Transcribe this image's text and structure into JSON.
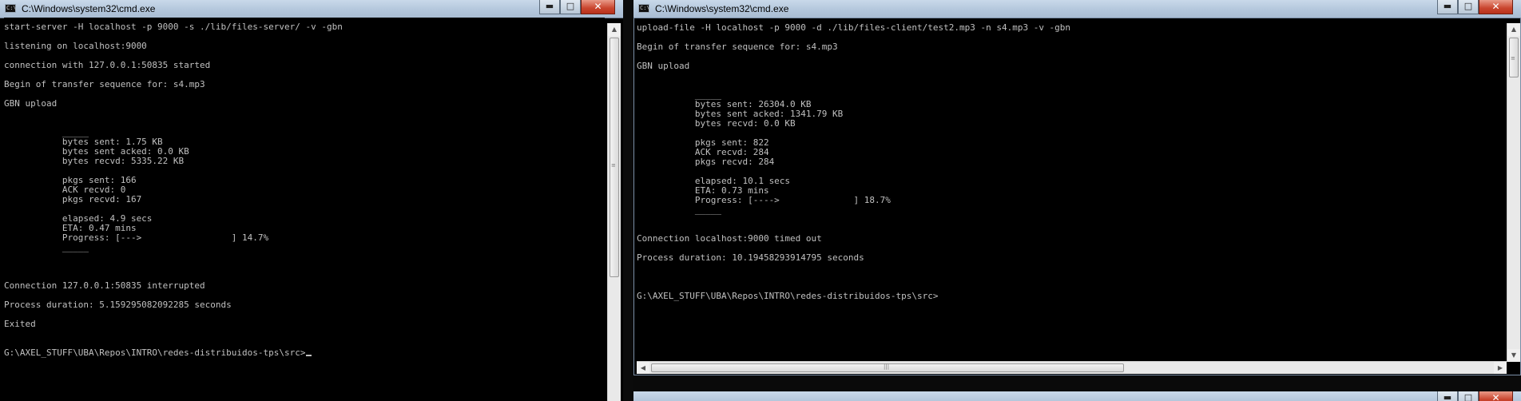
{
  "left_window": {
    "title": "C:\\Windows\\system32\\cmd.exe",
    "icon": "console-icon",
    "buttons": {
      "minimize": "minimize-icon",
      "maximize": "maximize-icon",
      "close": "close-icon"
    },
    "lines": [
      "start-server -H localhost -p 9000 -s ./lib/files-server/ -v -gbn",
      "",
      "listening on localhost:9000",
      "",
      "connection with 127.0.0.1:50835 started",
      "",
      "Begin of transfer sequence for: s4.mp3",
      "",
      "GBN upload",
      "",
      "",
      "           _____",
      "           bytes sent: 1.75 KB",
      "           bytes sent acked: 0.0 KB",
      "           bytes recvd: 5335.22 KB",
      "",
      "           pkgs sent: 166",
      "           ACK recvd: 0",
      "           pkgs recvd: 167",
      "",
      "           elapsed: 4.9 secs",
      "           ETA: 0.47 mins",
      "           Progress: [--->                 ] 14.7%",
      "           _____",
      "",
      "",
      "",
      "Connection 127.0.0.1:50835 interrupted",
      "",
      "Process duration: 5.159295082092285 seconds",
      "",
      "Exited",
      "",
      "",
      "G:\\AXEL_STUFF\\UBA\\Repos\\INTRO\\redes-distribuidos-tps\\src>"
    ]
  },
  "right_window": {
    "title": "C:\\Windows\\system32\\cmd.exe",
    "icon": "console-icon",
    "buttons": {
      "minimize": "minimize-icon",
      "maximize": "maximize-icon",
      "close": "close-icon"
    },
    "lines": [
      "upload-file -H localhost -p 9000 -d ./lib/files-client/test2.mp3 -n s4.mp3 -v -gbn",
      "",
      "Begin of transfer sequence for: s4.mp3",
      "",
      "GBN upload",
      "",
      "",
      "           _____",
      "           bytes sent: 26304.0 KB",
      "           bytes sent acked: 1341.79 KB",
      "           bytes recvd: 0.0 KB",
      "",
      "           pkgs sent: 822",
      "           ACK recvd: 284",
      "           pkgs recvd: 284",
      "",
      "           elapsed: 10.1 secs",
      "           ETA: 0.73 mins",
      "           Progress: [---->              ] 18.7%",
      "           _____",
      "",
      "",
      "Connection localhost:9000 timed out",
      "",
      "Process duration: 10.19458293914795 seconds",
      "",
      "",
      "",
      "G:\\AXEL_STUFF\\UBA\\Repos\\INTRO\\redes-distribuidos-tps\\src>"
    ]
  },
  "colors": {
    "console_bg": "#000000",
    "console_text": "#c0c0c0",
    "titlebar": "#b4c7dc",
    "close_button": "#c9452e"
  }
}
